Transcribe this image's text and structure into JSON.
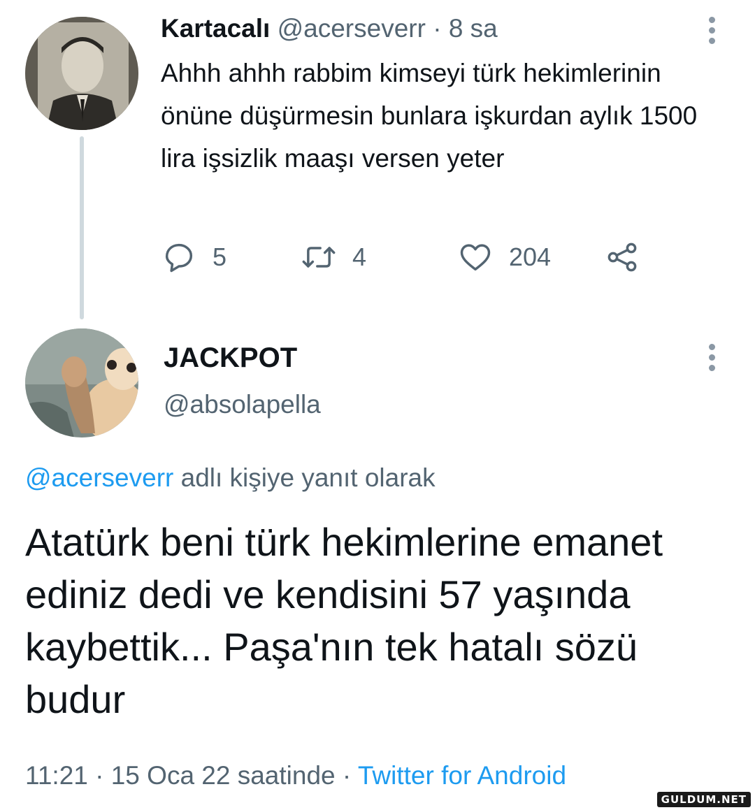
{
  "reply_thread": {
    "parent_tweet": {
      "author_name": "Kartacalı",
      "author_handle": "@acerseverr",
      "separator": "·",
      "time_ago": "8 sa",
      "text": "Ahhh ahhh rabbim kimseyi türk hekimlerinin önüne düşürmesin bunlara işkurdan aylık 1500 lira işsizlik maaşı versen yeter",
      "actions": {
        "reply_count": "5",
        "retweet_count": "4",
        "like_count": "204"
      }
    },
    "main_tweet": {
      "author_name": "JACKPOT",
      "author_handle": "@absolapella",
      "reply_to_handle": "@acerseverr",
      "reply_to_suffix": " adlı kişiye yanıt olarak",
      "text": "Atatürk beni türk hekimlerine emanet ediniz dedi ve kendisini 57 yaşında kaybettik... Paşa'nın tek hatalı sözü budur",
      "timestamp": "11:21 · 15 Oca 22 saatinde · ",
      "source": "Twitter for Android"
    }
  },
  "watermark": "GULDUM.NET",
  "colors": {
    "text_primary": "#0f1419",
    "text_secondary": "#536471",
    "link": "#1d9bf0",
    "thread_line": "#cfd9de"
  },
  "icons": [
    "reply-icon",
    "retweet-icon",
    "like-icon",
    "share-icon",
    "more-options-icon"
  ]
}
